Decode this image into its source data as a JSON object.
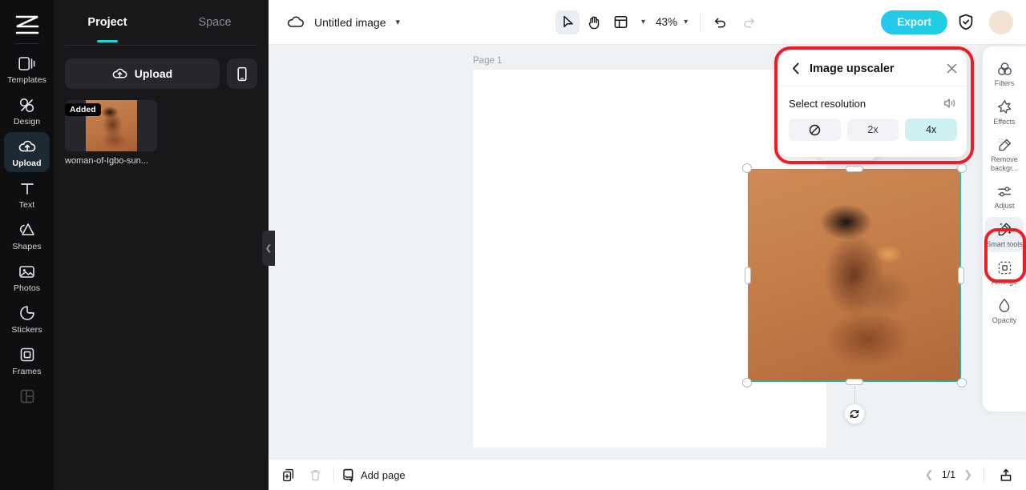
{
  "left_rail": {
    "logo_icon": "capcut-logo-icon",
    "items": [
      {
        "label": "Templates",
        "icon": "templates-icon",
        "active": false
      },
      {
        "label": "Design",
        "icon": "design-icon",
        "active": false
      },
      {
        "label": "Upload",
        "icon": "upload-cloud-icon",
        "active": true
      },
      {
        "label": "Text",
        "icon": "text-icon",
        "active": false
      },
      {
        "label": "Shapes",
        "icon": "shapes-icon",
        "active": false
      },
      {
        "label": "Photos",
        "icon": "photos-icon",
        "active": false
      },
      {
        "label": "Stickers",
        "icon": "stickers-icon",
        "active": false
      },
      {
        "label": "Frames",
        "icon": "frames-icon",
        "active": false
      },
      {
        "label": "",
        "icon": "layout-grid-icon",
        "active": false
      }
    ]
  },
  "panel": {
    "tabs": [
      {
        "label": "Project",
        "active": true
      },
      {
        "label": "Space",
        "active": false
      }
    ],
    "upload_label": "Upload",
    "upload_icon": "upload-cloud-icon",
    "phone_icon": "mobile-phone-icon",
    "collapse_icon": "chevron-left-icon",
    "assets": [
      {
        "badge": "Added",
        "caption": "woman-of-Igbo-sun..."
      }
    ]
  },
  "topbar": {
    "cloud_icon": "cloud-save-icon",
    "doc_title": "Untitled image",
    "title_caret_icon": "chevron-down-icon",
    "tools": [
      {
        "name": "select-tool",
        "icon": "cursor-arrow-icon",
        "selected": true
      },
      {
        "name": "hand-tool",
        "icon": "hand-icon",
        "selected": false
      },
      {
        "name": "layout-tool",
        "icon": "layout-panel-icon",
        "selected": false
      }
    ],
    "layout_caret_icon": "chevron-down-icon",
    "zoom_value": "43%",
    "zoom_caret_icon": "chevron-down-icon",
    "undo_icon": "undo-arrow-icon",
    "redo_icon": "redo-arrow-icon",
    "export_label": "Export",
    "export_color": "#22cbe3",
    "shield_icon": "shield-check-icon",
    "avatar_icon": "user-avatar"
  },
  "canvas": {
    "page_label": "Page 1",
    "background_color": "#eff2f5",
    "page_color": "#ffffff",
    "selection_color": "#2ab8b8",
    "float_toolbar": [
      {
        "name": "duplicate-layer-button",
        "icon": "duplicate-icon"
      },
      {
        "name": "more-options-button",
        "icon": "ellipsis-icon"
      }
    ],
    "rotate_icon": "rotate-icon"
  },
  "upscaler": {
    "back_icon": "chevron-left-icon",
    "title": "Image upscaler",
    "close_icon": "close-x-icon",
    "section_label": "Select resolution",
    "speaker_icon": "speaker-volume-icon",
    "highlight_color": "#ee1c25",
    "selected_color": "#cdf1f2",
    "options": [
      {
        "label": "",
        "icon": "no-entry-icon",
        "selected": false
      },
      {
        "label": "2x",
        "icon": "",
        "selected": false
      },
      {
        "label": "4x",
        "icon": "",
        "selected": true
      }
    ]
  },
  "right_rail": {
    "tools": [
      {
        "label": "Filters",
        "icon": "filters-circles-icon",
        "active": false
      },
      {
        "label": "Effects",
        "icon": "effects-star-icon",
        "active": false
      },
      {
        "label": "Remove backgr...",
        "icon": "remove-background-icon",
        "active": false
      },
      {
        "label": "Adjust",
        "icon": "adjust-sliders-icon",
        "active": false
      },
      {
        "label": "Smart tools",
        "icon": "magic-wand-icon",
        "active": true
      },
      {
        "label": "Arrange",
        "icon": "arrange-icon",
        "active": false
      },
      {
        "label": "Opacity",
        "icon": "opacity-drop-icon",
        "active": false
      }
    ]
  },
  "bottombar": {
    "duplicate_page_icon": "duplicate-page-icon",
    "delete_page_icon": "trash-icon",
    "add_page_icon": "add-page-icon",
    "add_page_label": "Add page",
    "prev_icon": "chevron-left-icon",
    "page_count": "1/1",
    "next_icon": "chevron-right-icon",
    "export_local_icon": "upload-tray-icon"
  }
}
